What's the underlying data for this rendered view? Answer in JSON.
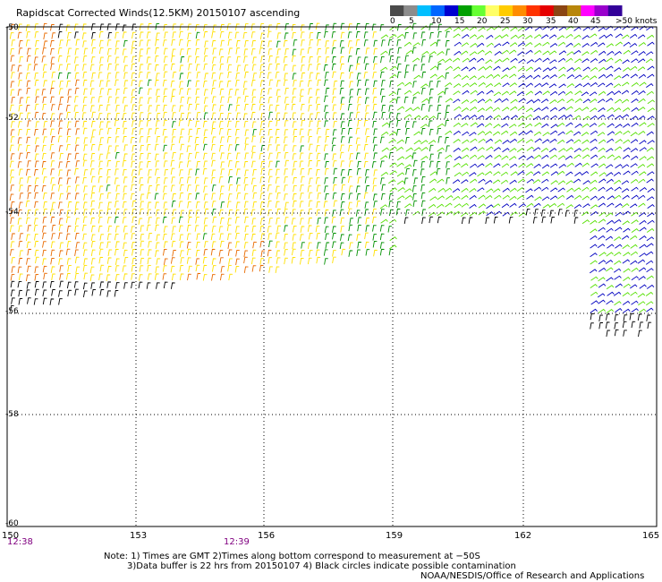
{
  "title": "Rapidscat Corrected Winds(12.5KM) 20150107 ascending",
  "legend": {
    "colors": [
      "#4a4a4a",
      "#8c8c8c",
      "#00bfff",
      "#0066ff",
      "#0000d0",
      "#00a000",
      "#66ff33",
      "#ffff66",
      "#ffcc00",
      "#ff8c00",
      "#ff3300",
      "#e60000",
      "#8b4513",
      "#b8860b",
      "#ff00ff",
      "#9900cc",
      "#330099"
    ],
    "labels": [
      "0",
      "5",
      "10",
      "15",
      "20",
      "25",
      "30",
      "35",
      "40",
      "45",
      ">50 knots"
    ]
  },
  "lat_labels": [
    "-50",
    "-52",
    "-54",
    "-56",
    "-58",
    "-60"
  ],
  "lon_labels": [
    "150",
    "153",
    "156",
    "159",
    "162",
    "165"
  ],
  "times": [
    "12:38",
    "12:39"
  ],
  "notes": [
    "Note: 1) Times are GMT 2)Times along bottom correspond to measurement at −50S",
    "3)Data buffer is 22 hrs from 20150107 4) Black circles indicate possible contamination"
  ],
  "credit": "NOAA/NESDIS/Office of Research and Applications",
  "wind_colors": {
    "orange": "#e86a00",
    "yellow": "#ffe000",
    "lightgreen": "#55e000",
    "green": "#009000",
    "blue": "#0000c0",
    "black": "#000000"
  }
}
